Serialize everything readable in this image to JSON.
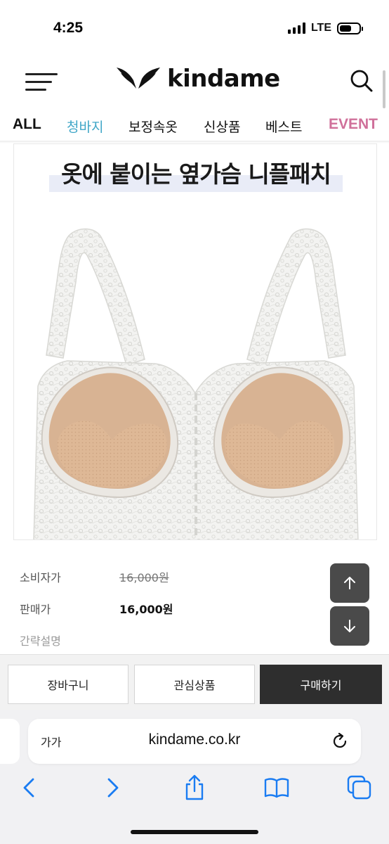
{
  "status_bar": {
    "time": "4:25",
    "network": "LTE",
    "icons": [
      "signal-bars-icon",
      "battery-icon"
    ]
  },
  "header": {
    "brand": "kindame",
    "icons": [
      "hamburger-menu-icon",
      "wings-logo-icon",
      "search-icon"
    ]
  },
  "categories": [
    {
      "label": "ALL"
    },
    {
      "label": "청바지"
    },
    {
      "label": "보정속옷"
    },
    {
      "label": "신상품"
    },
    {
      "label": "베스트"
    },
    {
      "label": "EVENT"
    }
  ],
  "product": {
    "headline": "옷에 붙이는 옆가슴 니플패치",
    "image_icon": "lace-bodysuit-with-padded-cups"
  },
  "info": {
    "consumer_price_label": "소비자가",
    "consumer_price": "16,000원",
    "sale_price_label": "판매가",
    "sale_price": "16,000원",
    "summary_label": "간략설명"
  },
  "scroll_buttons": {
    "icons": [
      "arrow-up-icon",
      "arrow-down-icon"
    ]
  },
  "actions": {
    "cart": "장바구니",
    "wishlist": "관심상품",
    "buy": "구매하기"
  },
  "browser": {
    "text_size_button": "가가",
    "url": "kindame.co.kr",
    "icons": [
      "reload-icon",
      "back-icon",
      "forward-icon",
      "share-icon",
      "bookmarks-icon",
      "tabs-icon"
    ]
  },
  "colors": {
    "active_category": "#3fa6c7",
    "event_category": "#d0709a",
    "buy_button": "#2e2e2e",
    "scroll_button": "#4a4a4a",
    "safari_accent": "#1a7cf2",
    "headline_highlight": "#e9ecf7"
  }
}
